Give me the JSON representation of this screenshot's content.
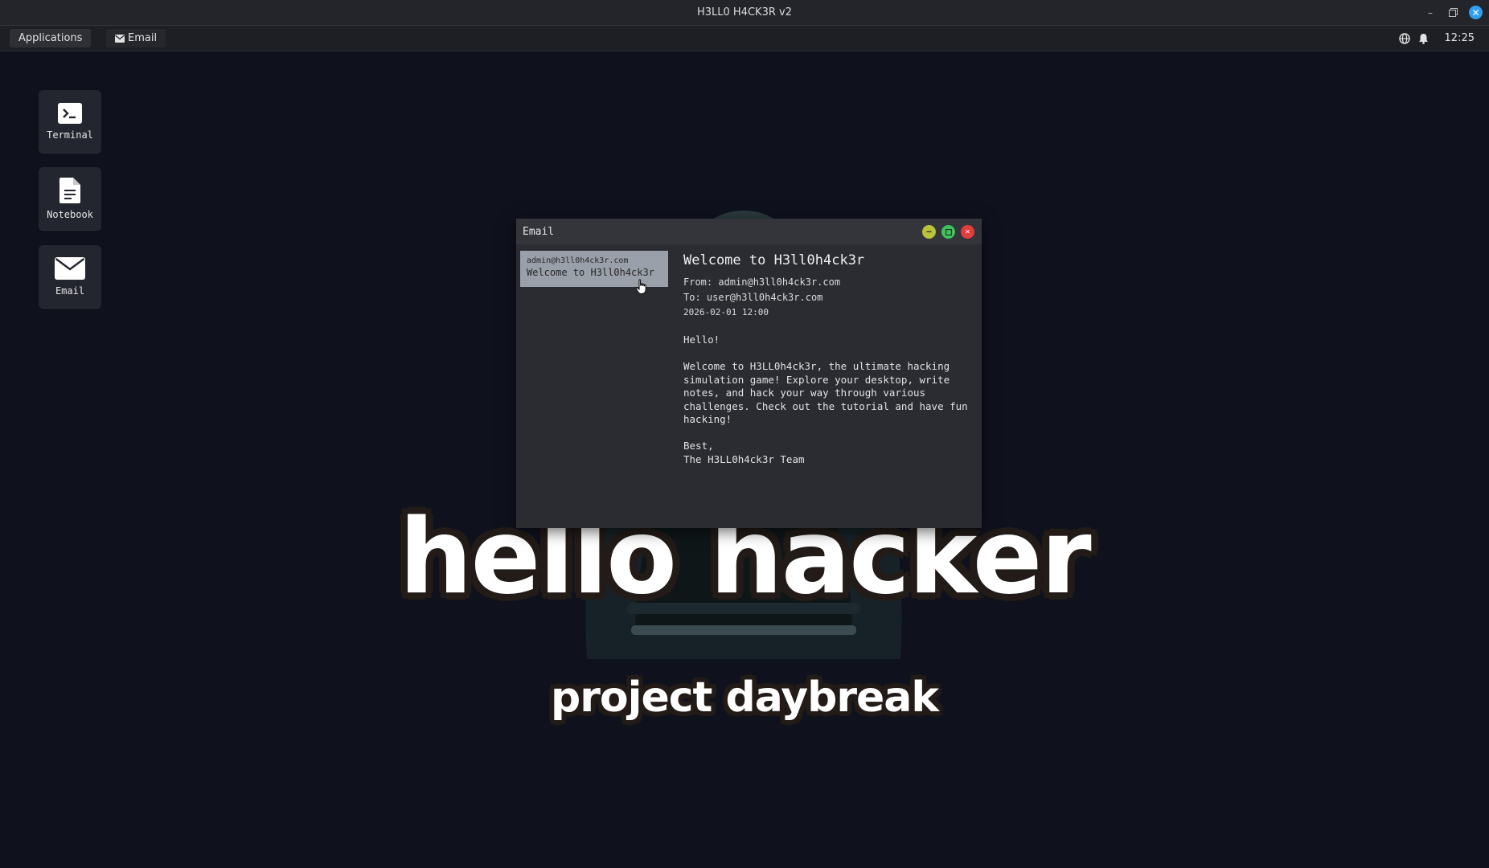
{
  "os": {
    "title": "H3LL0 H4CK3R v2"
  },
  "panel": {
    "applications_label": "Applications",
    "email_label": "Email",
    "clock": "12:25"
  },
  "desktop": {
    "icons": [
      {
        "label": "Terminal",
        "icon": "terminal-icon"
      },
      {
        "label": "Notebook",
        "icon": "notebook-icon"
      },
      {
        "label": "Email",
        "icon": "envelope-icon"
      }
    ]
  },
  "wallpaper": {
    "headline": "hello hacker",
    "subheadline": "project daybreak"
  },
  "email_window": {
    "title": "Email",
    "inbox": [
      {
        "from": "admin@h3ll0h4ck3r.com",
        "subject": "Welcome to H3ll0h4ck3r"
      }
    ],
    "message": {
      "subject": "Welcome to H3ll0h4ck3r",
      "from_line": "From: admin@h3ll0h4ck3r.com",
      "to_line": "To: user@h3ll0h4ck3r.com",
      "date": "2026-02-01 12:00",
      "body": "Hello!\n\nWelcome to H3LL0h4ck3r, the ultimate hacking\nsimulation game! Explore your desktop, write\nnotes, and hack your way through various\nchallenges. Check out the tutorial and have fun\nhacking!\n\nBest,\nThe H3LL0h4ck3r Team"
    }
  },
  "colors": {
    "desktop_bg": "#0f111d",
    "accent_close": "#2f9ff0",
    "selected_item": "#9aa0aa"
  }
}
